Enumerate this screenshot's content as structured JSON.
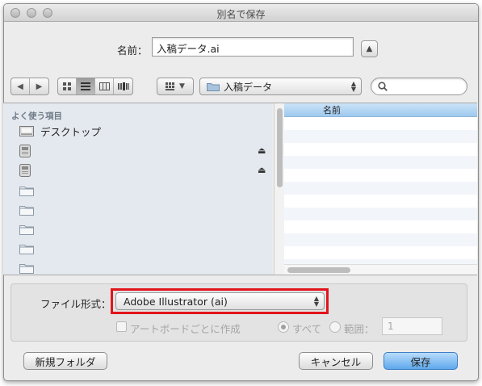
{
  "window": {
    "title": "別名で保存"
  },
  "name_row": {
    "label": "名前：",
    "value": "入稿データ.ai"
  },
  "toolbar": {
    "path_folder": "入稿データ",
    "search_placeholder": ""
  },
  "sidebar": {
    "heading": "よく使う項目",
    "items": [
      {
        "label": "デスクトップ",
        "icon": "desktop-icon"
      },
      {
        "label": "",
        "icon": "disk-icon",
        "eject": true
      },
      {
        "label": "",
        "icon": "disk-icon",
        "eject": true
      },
      {
        "label": "",
        "icon": "folder-icon"
      },
      {
        "label": "",
        "icon": "folder-icon"
      },
      {
        "label": "",
        "icon": "folder-icon"
      },
      {
        "label": "",
        "icon": "folder-icon"
      },
      {
        "label": "",
        "icon": "folder-icon"
      }
    ]
  },
  "file_list": {
    "column_header": "名前",
    "rows": []
  },
  "options": {
    "format_label": "ファイル形式：",
    "format_value": "Adobe Illustrator (ai)",
    "artboard_label": "アートボードごとに作成",
    "radio_all_label": "すべて",
    "radio_range_label": "範囲：",
    "range_value": "1"
  },
  "buttons": {
    "new_folder": "新規フォルダ",
    "cancel": "キャンセル",
    "save": "保存"
  },
  "colors": {
    "highlight": "#e2141c",
    "default_button": "#5ea8ec",
    "list_header": "#b5d7f4"
  }
}
